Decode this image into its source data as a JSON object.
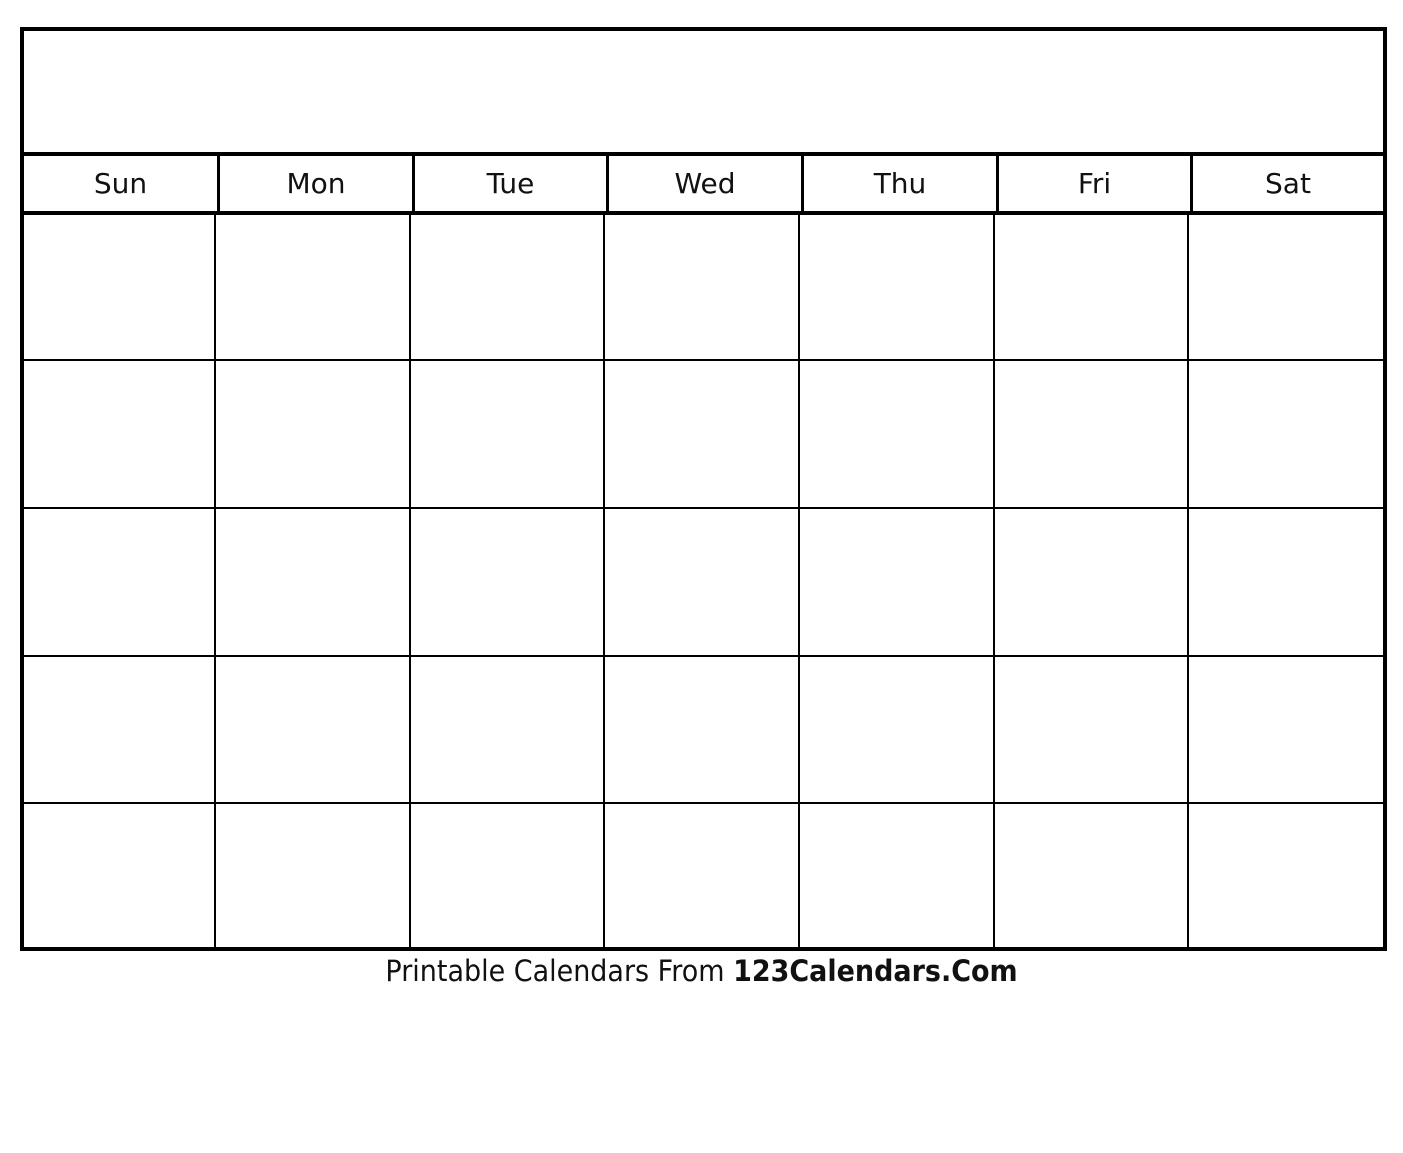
{
  "calendar": {
    "title": "",
    "weekdays": [
      "Sun",
      "Mon",
      "Tue",
      "Wed",
      "Thu",
      "Fri",
      "Sat"
    ],
    "weeks": [
      [
        "",
        "",
        "",
        "",
        "",
        "",
        ""
      ],
      [
        "",
        "",
        "",
        "",
        "",
        "",
        ""
      ],
      [
        "",
        "",
        "",
        "",
        "",
        "",
        ""
      ],
      [
        "",
        "",
        "",
        "",
        "",
        "",
        ""
      ],
      [
        "",
        "",
        "",
        "",
        "",
        "",
        ""
      ]
    ]
  },
  "footer": {
    "prefix": "Printable Calendars From ",
    "brand": "123Calendars.Com"
  }
}
